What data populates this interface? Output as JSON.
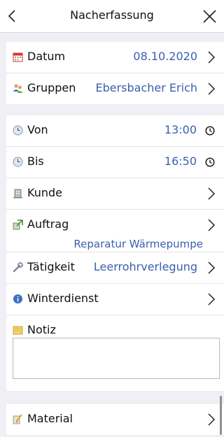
{
  "header": {
    "title": "Nacherfassung",
    "back_icon": "chevron-left-icon",
    "close_icon": "close-icon"
  },
  "section1": {
    "datum": {
      "label": "Datum",
      "value": "08.10.2020",
      "icon": "calendar-icon"
    },
    "gruppen": {
      "label": "Gruppen",
      "value": "Ebersbacher Erich",
      "icon": "group-icon"
    }
  },
  "section2": {
    "von": {
      "label": "Von",
      "value": "13:00",
      "icon": "clock-icon"
    },
    "bis": {
      "label": "Bis",
      "value": "16:50",
      "icon": "clock-icon"
    },
    "kunde": {
      "label": "Kunde",
      "icon": "building-icon"
    },
    "auftrag": {
      "label": "Auftrag",
      "value": "Reparatur Wärmepumpe",
      "icon": "order-icon"
    },
    "taetigkeit": {
      "label": "Tätigkeit",
      "value": "Leerrohrverlegung",
      "icon": "wrench-icon"
    },
    "winterdienst": {
      "label": "Winterdienst",
      "icon": "info-icon"
    },
    "notiz": {
      "label": "Notiz",
      "value": "",
      "icon": "note-icon"
    }
  },
  "section3": {
    "material": {
      "label": "Material",
      "icon": "material-icon"
    }
  },
  "colors": {
    "accent": "#3a5fb0",
    "background": "#efeff4",
    "cell": "#ffffff"
  }
}
